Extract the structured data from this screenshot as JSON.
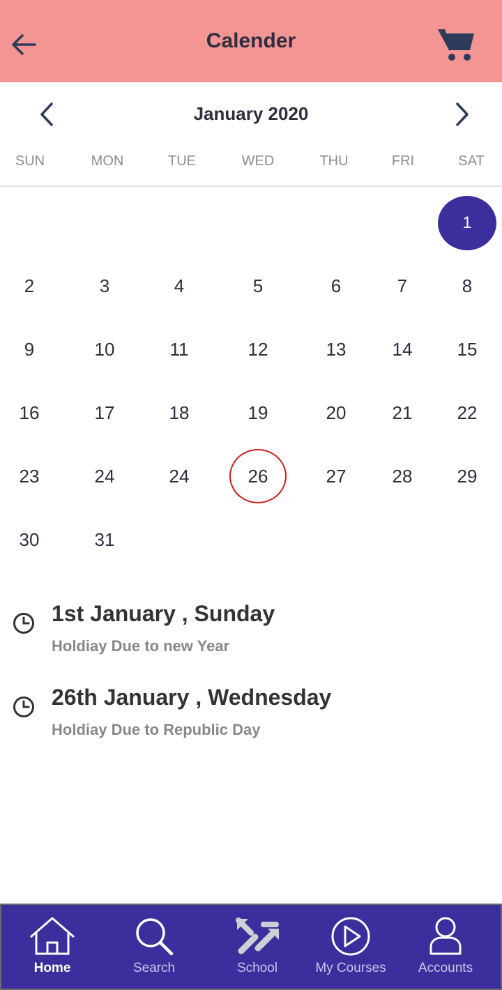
{
  "header": {
    "title": "Calender",
    "back_icon": "arrow-left-icon",
    "cart_icon": "cart-icon"
  },
  "calendar": {
    "month_label": "January 2020",
    "weekdays": [
      "SUN",
      "MON",
      "TUE",
      "WED",
      "THU",
      "FRI",
      "SAT"
    ],
    "selected_day": "1",
    "marked_day": "26",
    "selected_color": "#3a2f9c",
    "marked_color": "#cc1f1f",
    "weeks": [
      [
        "",
        "",
        "",
        "",
        "",
        "",
        "1"
      ],
      [
        "2",
        "3",
        "4",
        "5",
        "6",
        "7",
        "8"
      ],
      [
        "9",
        "10",
        "11",
        "12",
        "13",
        "14",
        "15"
      ],
      [
        "16",
        "17",
        "18",
        "19",
        "20",
        "21",
        "22"
      ],
      [
        "23",
        "24",
        "24",
        "26",
        "27",
        "28",
        "29"
      ],
      [
        "30",
        "31",
        "",
        "",
        "",
        "",
        ""
      ]
    ]
  },
  "events": [
    {
      "title": "1st January , Sunday",
      "subtitle": "Holdiay Due to new Year"
    },
    {
      "title": "26th January , Wednesday",
      "subtitle": "Holdiay Due to Republic Day"
    }
  ],
  "bottom_nav": {
    "items": [
      {
        "label": "Home",
        "icon": "home-icon",
        "active": true
      },
      {
        "label": "Search",
        "icon": "search-icon",
        "active": false
      },
      {
        "label": "School",
        "icon": "school-icon",
        "active": false
      },
      {
        "label": "My Courses",
        "icon": "play-icon",
        "active": false
      },
      {
        "label": "Accounts",
        "icon": "user-icon",
        "active": false
      }
    ]
  },
  "colors": {
    "header_bg": "#f29593",
    "nav_bg": "#3a2f9c",
    "accent": "#3a2f9c"
  }
}
